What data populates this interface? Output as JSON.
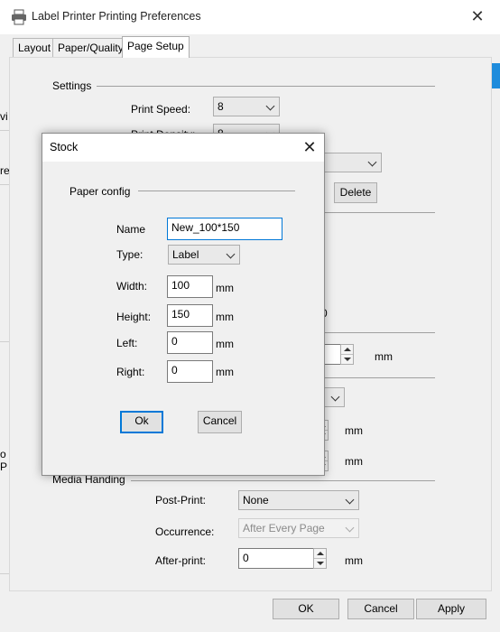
{
  "window": {
    "title": "Label Printer Printing Preferences",
    "close_glyph": "✕",
    "accent_color": "#0078d7"
  },
  "tabs": [
    {
      "label": "Layout"
    },
    {
      "label": "Paper/Quality"
    },
    {
      "label": "Page Setup",
      "active": true
    }
  ],
  "left_strip": {
    "text_a": "vi",
    "text_b": "re",
    "text_c": "o",
    "text_d": "P"
  },
  "settings": {
    "group_label": "Settings",
    "print_speed_label": "Print Speed:",
    "print_speed_value": "8",
    "print_density_label": "Print Density:",
    "print_density_value": "8",
    "delete_label": "Delete",
    "partial_value": "0",
    "mm_1": "mm",
    "mm_2": "mm",
    "mm_3": "mm"
  },
  "media_handling": {
    "group_label": "Media Handing",
    "post_print_label": "Post-Print:",
    "post_print_value": "None",
    "occurrence_label": "Occurrence:",
    "occurrence_value": "After Every Page",
    "after_print_label": "After-print:",
    "after_print_value": "0",
    "mm": "mm"
  },
  "footer": {
    "ok": "OK",
    "cancel": "Cancel",
    "apply": "Apply"
  },
  "dialog": {
    "title": "Stock",
    "close_glyph": "✕",
    "group_label": "Paper config",
    "name_label": "Name",
    "name_value": "New_100*150",
    "type_label": "Type:",
    "type_value": "Label",
    "width_label": "Width:",
    "width_value": "100",
    "height_label": "Height:",
    "height_value": "150",
    "left_label": "Left:",
    "left_value": "0",
    "right_label": "Right:",
    "right_value": "0",
    "unit": "mm",
    "ok": "Ok",
    "cancel": "Cancel"
  }
}
